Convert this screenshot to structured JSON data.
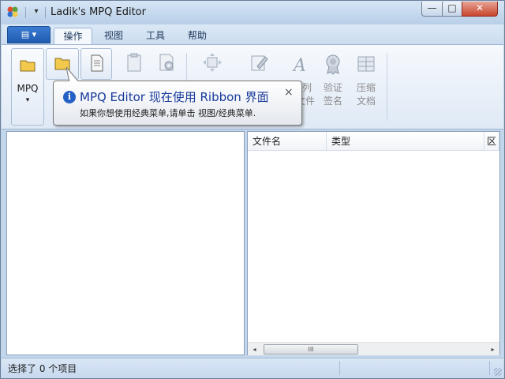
{
  "window": {
    "title": "Ladik's MPQ Editor",
    "controls": {
      "minimize": "—",
      "maximize": "□",
      "close": "✕"
    }
  },
  "quick_access": {
    "customize_glyph": "▾"
  },
  "ribbon": {
    "app_menu_glyph": "▤ ▾",
    "tabs": [
      {
        "label": "操作",
        "active": true
      },
      {
        "label": "视图",
        "active": false
      },
      {
        "label": "工具",
        "active": false
      },
      {
        "label": "帮助",
        "active": false
      }
    ],
    "mpq_button": {
      "label": "MPQ",
      "arrow": "▾"
    },
    "sign_button": {
      "line1": "验证",
      "line2": "签名"
    },
    "compact_button": {
      "line1": "压缩",
      "line2": "文档"
    },
    "partial_label": {
      "line1": "列",
      "line2": "文件"
    }
  },
  "tooltip": {
    "info_glyph": "i",
    "title": "MPQ Editor 现在使用 Ribbon 界面",
    "body": "如果你想使用经典菜单,请单击 视图/经典菜单.",
    "close_glyph": "×"
  },
  "file_list": {
    "columns": [
      "文件名",
      "类型",
      "区"
    ],
    "scroll": {
      "left": "◂",
      "right": "▸",
      "thumb": "III"
    }
  },
  "status": {
    "text": "选择了 0 个项目"
  },
  "colors": {
    "title_blue": "#1a3b9c",
    "app_menu_blue": "#2b6cc4",
    "folder_yellow": "#f2c94c",
    "close_red": "#c8452d"
  }
}
